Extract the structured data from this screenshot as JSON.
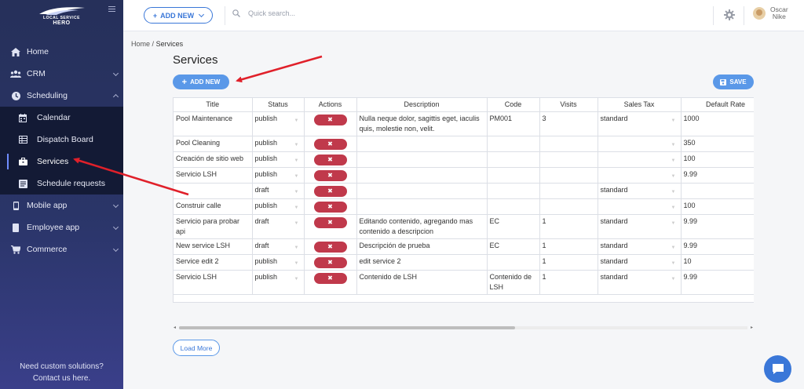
{
  "sidebar": {
    "logo_line1": "LOCAL SERVICE",
    "logo_line2": "HERO",
    "items": [
      {
        "label": "Home",
        "icon": "home-icon"
      },
      {
        "label": "CRM",
        "icon": "users-icon"
      },
      {
        "label": "Scheduling",
        "icon": "clock-icon"
      },
      {
        "label": "Calendar",
        "icon": "calendar-icon"
      },
      {
        "label": "Dispatch Board",
        "icon": "grid-icon"
      },
      {
        "label": "Services",
        "icon": "briefcase-icon"
      },
      {
        "label": "Schedule requests",
        "icon": "list-icon"
      },
      {
        "label": "Mobile app",
        "icon": "mobile-icon"
      },
      {
        "label": "Employee app",
        "icon": "document-icon"
      },
      {
        "label": "Commerce",
        "icon": "cart-icon"
      }
    ],
    "help_line1": "Need custom solutions?",
    "help_line2": "Contact us here."
  },
  "topbar": {
    "add_new_label": "ADD NEW",
    "search_placeholder": "Quick search...",
    "user_first": "Oscar",
    "user_last": "Nike"
  },
  "breadcrumb": {
    "home": "Home",
    "separator": "/",
    "current": "Services"
  },
  "page": {
    "title": "Services",
    "add_new_label": "ADD NEW",
    "save_label": "SAVE",
    "load_more_label": "Load More"
  },
  "table": {
    "columns": [
      "Title",
      "Status",
      "Actions",
      "Description",
      "Code",
      "Visits",
      "Sales Tax",
      "Default Rate"
    ],
    "delete_label": "✖",
    "rows": [
      {
        "title": "Pool Maintenance",
        "status": "publish",
        "description": "Nulla neque dolor, sagittis eget, iaculis quis, molestie non, velit.",
        "code": "PM001",
        "visits": "3",
        "tax": "standard",
        "rate": "1000"
      },
      {
        "title": "Pool Cleaning",
        "status": "publish",
        "description": "",
        "code": "",
        "visits": "",
        "tax": "",
        "rate": "350"
      },
      {
        "title": "Creación de sitio web",
        "status": "publish",
        "description": "",
        "code": "",
        "visits": "",
        "tax": "",
        "rate": "100"
      },
      {
        "title": "Servicio LSH",
        "status": "publish",
        "description": "",
        "code": "",
        "visits": "",
        "tax": "",
        "rate": "9.99"
      },
      {
        "title": "",
        "status": "draft",
        "description": "",
        "code": "",
        "visits": "",
        "tax": "standard",
        "rate": ""
      },
      {
        "title": "Construir calle",
        "status": "publish",
        "description": "",
        "code": "",
        "visits": "",
        "tax": "",
        "rate": "100"
      },
      {
        "title": "Servicio para probar api",
        "status": "draft",
        "description": "Editando contenido, agregando mas contenido a descripcion",
        "code": "EC",
        "visits": "1",
        "tax": "standard",
        "rate": "9.99"
      },
      {
        "title": "New service LSH",
        "status": "draft",
        "description": "Descripción de prueba",
        "code": "EC",
        "visits": "1",
        "tax": "standard",
        "rate": "9.99"
      },
      {
        "title": "Service edit 2",
        "status": "publish",
        "description": "edit service 2",
        "code": "",
        "visits": "1",
        "tax": "standard",
        "rate": "10"
      },
      {
        "title": "Servicio LSH",
        "status": "publish",
        "description": "Contenido de LSH",
        "code": "Contenido de LSH",
        "visits": "1",
        "tax": "standard",
        "rate": "9.99"
      }
    ]
  },
  "colors": {
    "sidebar": "#26305a",
    "submenu": "#131a35",
    "accent": "#5a98e8",
    "delete": "#c0394b",
    "annotation_arrow": "#e0202a"
  }
}
